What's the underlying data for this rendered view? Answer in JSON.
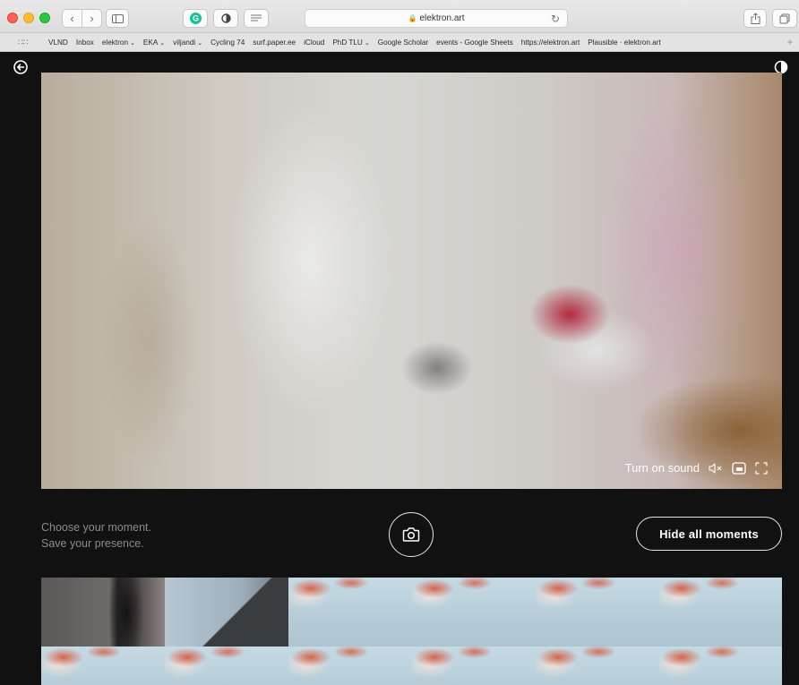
{
  "browser": {
    "url": "elektron.art",
    "bookmarks": [
      {
        "label": "VLND",
        "has_menu": false
      },
      {
        "label": "Inbox",
        "has_menu": false
      },
      {
        "label": "elektron",
        "has_menu": true
      },
      {
        "label": "EKA",
        "has_menu": true
      },
      {
        "label": "viljandi",
        "has_menu": true
      },
      {
        "label": "Cycling 74",
        "has_menu": false
      },
      {
        "label": "surf.paper.ee",
        "has_menu": false
      },
      {
        "label": "iCloud",
        "has_menu": false
      },
      {
        "label": "PhD TLU",
        "has_menu": true
      },
      {
        "label": "Google Scholar",
        "has_menu": false
      },
      {
        "label": "events - Google Sheets",
        "has_menu": false
      },
      {
        "label": "https://elektron.art",
        "has_menu": false
      },
      {
        "label": "Plausible · elektron.art",
        "has_menu": false
      }
    ],
    "icons": [
      "sidebar-icon",
      "grammarly-icon",
      "privacy-icon",
      "reader-icon",
      "lock-icon",
      "reload-icon",
      "share-icon",
      "tabs-icon",
      "grid-icon",
      "chevron-down-icon"
    ]
  },
  "page": {
    "icons": [
      "back-arrow-icon",
      "contrast-icon"
    ],
    "video": {
      "sound_label": "Turn on sound",
      "icons": [
        "speaker-muted-icon",
        "picture-in-picture-icon",
        "fullscreen-icon"
      ]
    },
    "caption": {
      "line1": "Choose your moment.",
      "line2": "Save your presence."
    },
    "snapshot_icon": "camera-icon",
    "hide_button": "Hide all moments",
    "moments": [
      "dark",
      "grey",
      "hand",
      "hand",
      "hand",
      "hand",
      "hand",
      "hand",
      "hand",
      "hand",
      "hand",
      "hand"
    ]
  },
  "colors": {
    "background": "#111111",
    "accent": "#ffffff",
    "caption_text": "#8b8b8b"
  }
}
